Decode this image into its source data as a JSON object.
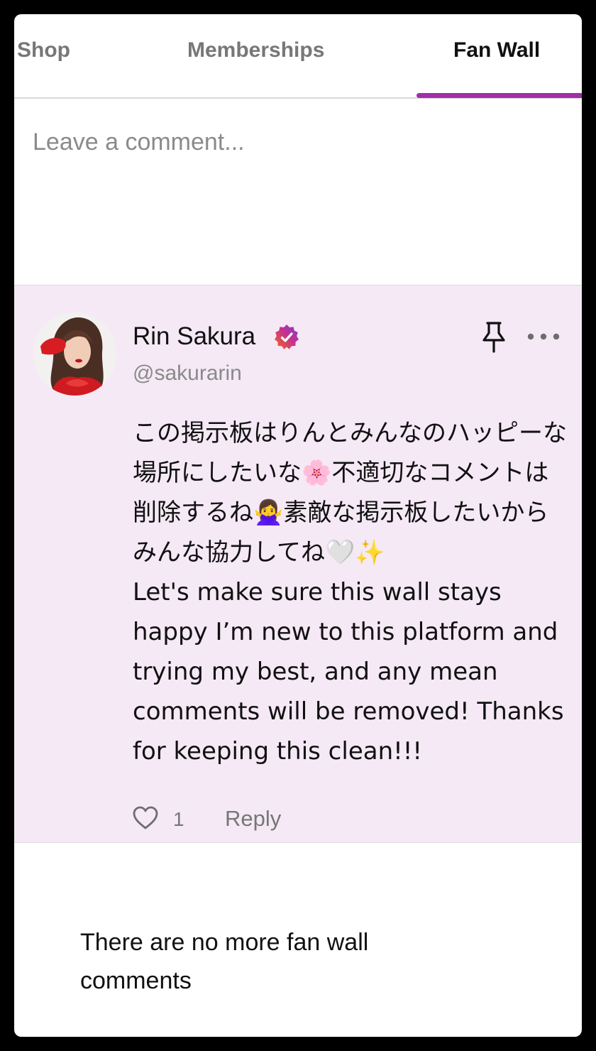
{
  "tabs": {
    "shop": "Shop",
    "memberships": "Memberships",
    "fan_wall": "Fan Wall",
    "active": "Fan Wall"
  },
  "comment_box": {
    "placeholder": "Leave a comment..."
  },
  "post": {
    "author_name": "Rin Sakura",
    "author_handle": "@sakurarin",
    "verified_icon": "verified-badge-icon",
    "pin_icon": "pin-icon",
    "more_icon": "more-horizontal-icon",
    "body": "この掲示板はりんとみんなのハッピーな場所にしたいな🌸不適切なコメントは削除するね🙅‍♀️素敵な掲示板したいからみんな協力してね🤍✨\nLet's make sure this wall stays happy I’m new to this platform and trying my best, and any mean comments will be removed! Thanks for keeping this clean!!!",
    "like_icon": "heart-icon",
    "like_count": "1",
    "reply_label": "Reply"
  },
  "empty_state": "There are no more fan wall comments",
  "colors": {
    "accent": "#a22ea8",
    "pinned_post_bg": "#f5e9f5"
  }
}
